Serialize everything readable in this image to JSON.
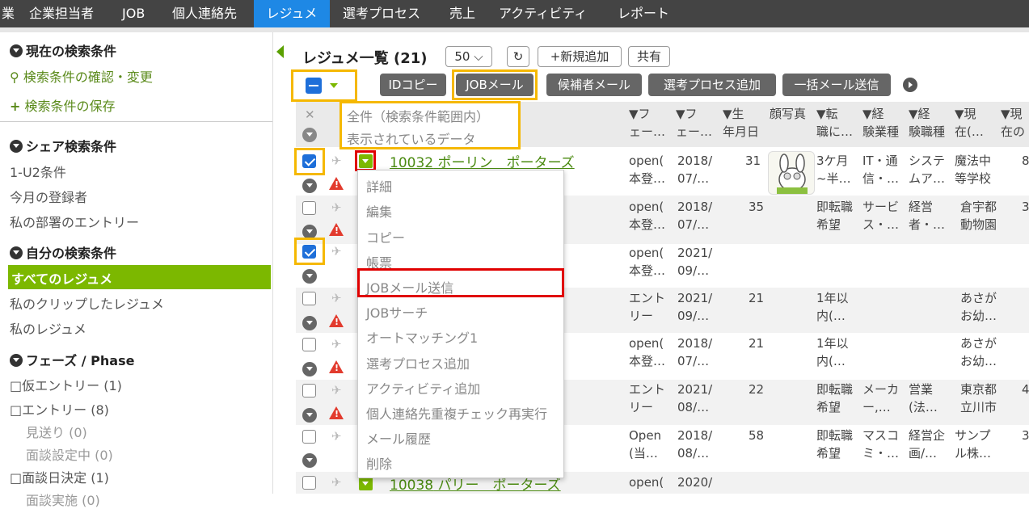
{
  "topnav": {
    "items": [
      "業",
      "企業担当者",
      "JOB",
      "個人連絡先",
      "レジュメ",
      "選考プロセス",
      "売上",
      "アクティビティ",
      "レポート"
    ],
    "active_index": 4
  },
  "sidebar": {
    "current_conditions": "現在の検索条件",
    "check_change": "検索条件の確認・変更",
    "save_conditions": "検索条件の保存",
    "share_conditions": "シェア検索条件",
    "share_items": [
      "1-U2条件",
      "今月の登録者",
      "私の部署のエントリー"
    ],
    "my_conditions": "自分の検索条件",
    "my_items": [
      "すべてのレジュメ",
      "私のクリップしたレジュメ",
      "私のレジュメ"
    ],
    "phase_title": "フェーズ / Phase",
    "phase_items": [
      "□仮エントリー (1)",
      "□エントリー (8)",
      "見送り (0)",
      "面談設定中 (0)",
      "□面談日決定 (1)",
      "面談実施 (0)"
    ]
  },
  "toolbar": {
    "title": "レジュメ一覧 (21)",
    "page_size": "50",
    "refresh_icon": "refresh-icon",
    "new_button": "+新規追加",
    "share_button": "共有",
    "action_buttons": [
      "IDコピー",
      "JOBメール",
      "候補者メール",
      "選考プロセス追加",
      "一括メール送信"
    ]
  },
  "select_menu": {
    "items": [
      "全件（検索条件範囲内）",
      "表示されているデータ"
    ]
  },
  "columns": {
    "headers": [
      [
        "▼フ",
        "ェー…"
      ],
      [
        "▼フ",
        "ェー…"
      ],
      [
        "▼生",
        "年月日"
      ],
      [
        "顔写真",
        ""
      ],
      [
        "▼転",
        "職に…"
      ],
      [
        "▼経",
        "験業種"
      ],
      [
        "▼経",
        "験職種"
      ],
      [
        "▼現",
        "在(…"
      ],
      [
        "▼現",
        "在の"
      ]
    ]
  },
  "rows": [
    {
      "id": "10032",
      "name": "ポーリン　ポーターズ",
      "c1": [
        "open(",
        "本登…"
      ],
      "c2": [
        "2018/",
        "07/…"
      ],
      "age": "31",
      "c4": [
        "3ケ月",
        "~半…"
      ],
      "c5": [
        "IT・通",
        "信・…"
      ],
      "c6": [
        "システ",
        "ムア…"
      ],
      "c7": [
        "魔法中",
        "等学校"
      ],
      "c8": "8",
      "checked": true,
      "warn": true
    },
    {
      "c1": [
        "open(",
        "本登…"
      ],
      "c2": [
        "2018/",
        "07/…"
      ],
      "age": "35",
      "c4": [
        "即転職",
        "希望"
      ],
      "c5": [
        "サービ",
        "ス・…"
      ],
      "c6": [
        "経営",
        "者・…"
      ],
      "c7": [
        "倉宇都",
        "動物園"
      ],
      "c8": "3",
      "checked": false,
      "warn": true
    },
    {
      "c1": [
        "open(",
        "本登…"
      ],
      "c2": [
        "2021/",
        "09/…"
      ],
      "age": "",
      "c4": [
        "",
        ""
      ],
      "c5": [
        "",
        ""
      ],
      "c6": [
        "",
        ""
      ],
      "c7": [
        "",
        ""
      ],
      "c8": "",
      "checked": true,
      "warn": false
    },
    {
      "c1": [
        "エント",
        "リー"
      ],
      "c2": [
        "2021/",
        "09/…"
      ],
      "age": "21",
      "c4": [
        "1年以",
        "内(…"
      ],
      "c5": [
        "",
        ""
      ],
      "c6": [
        "",
        ""
      ],
      "c7": [
        "あさが",
        "お幼…"
      ],
      "c8": "",
      "checked": false,
      "warn": true
    },
    {
      "c1": [
        "open(",
        "本登…"
      ],
      "c2": [
        "2018/",
        "07/…"
      ],
      "age": "21",
      "c4": [
        "1年以",
        "内(…"
      ],
      "c5": [
        "",
        ""
      ],
      "c6": [
        "",
        ""
      ],
      "c7": [
        "あさが",
        "お幼…"
      ],
      "c8": "",
      "checked": false,
      "warn": true
    },
    {
      "c1": [
        "エント",
        "リー"
      ],
      "c2": [
        "2021/",
        "08/…"
      ],
      "age": "22",
      "c4": [
        "即転職",
        "希望"
      ],
      "c5": [
        "メーカ",
        "ー,…"
      ],
      "c6": [
        "営業",
        "(法…"
      ],
      "c7": [
        "東京都",
        "立川市"
      ],
      "c8": "4",
      "checked": false,
      "warn": true
    },
    {
      "c1": [
        "Open",
        "(当…"
      ],
      "c2": [
        "2018/",
        "08/…"
      ],
      "age": "58",
      "c4": [
        "即転職",
        "希望"
      ],
      "c5": [
        "マスコ",
        "ミ・…"
      ],
      "c6": [
        "経営企",
        "画/…"
      ],
      "c7": [
        "サンプ",
        "ル株…"
      ],
      "c8": "3",
      "checked": false,
      "warn": false
    },
    {
      "id": "10038",
      "name": "パリー　ポーターズ",
      "c1": [
        "open(",
        ""
      ],
      "c2": [
        "2020/",
        ""
      ],
      "age": "",
      "c4": [
        "",
        ""
      ],
      "c5": [
        "",
        ""
      ],
      "c6": [
        "",
        ""
      ],
      "c7": [
        "",
        ""
      ],
      "c8": "",
      "checked": false,
      "warn": false
    }
  ],
  "row_menu": {
    "items": [
      "詳細",
      "編集",
      "コピー",
      "帳票",
      "JOBメール送信",
      "JOBサーチ",
      "オートマッチング1",
      "選考プロセス追加",
      "アクティビティ追加",
      "個人連絡先重複チェック再実行",
      "メール履歴",
      "削除"
    ],
    "highlighted": "JOBメール送信"
  },
  "colors": {
    "accent_green": "#7cb800",
    "nav_active": "#1e88e5",
    "highlight_yellow": "#f5b800",
    "highlight_red": "#e00000"
  }
}
